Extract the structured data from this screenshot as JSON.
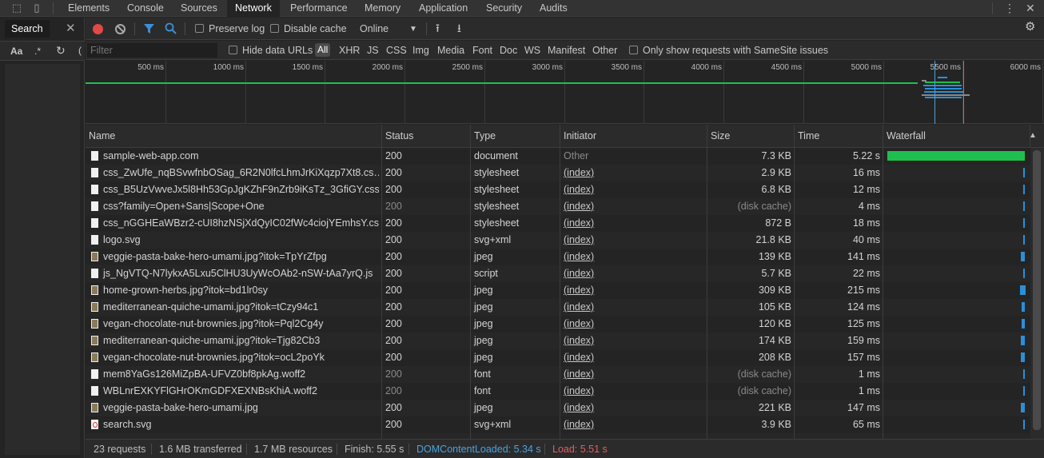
{
  "devtools": {
    "tabs": [
      "Elements",
      "Console",
      "Sources",
      "Network",
      "Performance",
      "Memory",
      "Application",
      "Security",
      "Audits"
    ],
    "active_tab": "Network"
  },
  "search_pane": {
    "tab_label": "Search",
    "match_case_label": "Aa",
    "regex_label": ".*"
  },
  "toolbar": {
    "preserve_log": "Preserve log",
    "disable_cache": "Disable cache",
    "throttling": "Online"
  },
  "filterbar": {
    "placeholder": "Filter",
    "hide_data_urls": "Hide data URLs",
    "types": [
      "All",
      "XHR",
      "JS",
      "CSS",
      "Img",
      "Media",
      "Font",
      "Doc",
      "WS",
      "Manifest",
      "Other"
    ],
    "samesite": "Only show requests with SameSite issues"
  },
  "overview": {
    "ticks": [
      "500 ms",
      "1000 ms",
      "1500 ms",
      "2000 ms",
      "2500 ms",
      "3000 ms",
      "3500 ms",
      "4000 ms",
      "4500 ms",
      "5000 ms",
      "5500 ms",
      "6000 ms"
    ],
    "dom_content_loaded_ms": 5340,
    "load_ms": 5510
  },
  "table": {
    "columns": [
      "Name",
      "Status",
      "Type",
      "Initiator",
      "Size",
      "Time",
      "Waterfall"
    ],
    "rows": [
      {
        "name": "sample-web-app.com",
        "status": "200",
        "type": "document",
        "initiator": "Other",
        "size": "7.3 KB",
        "time": "5.22 s",
        "icon": "doc",
        "status_dim": false,
        "size_dim": false,
        "init_link": false
      },
      {
        "name": "css_ZwUfe_nqBSvwfnbOSag_6R2N0lfcLhmJrKiXqzp7Xt8.cs…",
        "status": "200",
        "type": "stylesheet",
        "initiator": "(index)",
        "size": "2.9 KB",
        "time": "16 ms",
        "icon": "doc",
        "status_dim": false,
        "size_dim": false,
        "init_link": true
      },
      {
        "name": "css_B5UzVwveJx5l8Hh53GpJgKZhF9nZrb9iKsTz_3GfiGY.css…",
        "status": "200",
        "type": "stylesheet",
        "initiator": "(index)",
        "size": "6.8 KB",
        "time": "12 ms",
        "icon": "doc",
        "status_dim": false,
        "size_dim": false,
        "init_link": true
      },
      {
        "name": "css?family=Open+Sans|Scope+One",
        "status": "200",
        "type": "stylesheet",
        "initiator": "(index)",
        "size": "(disk cache)",
        "time": "4 ms",
        "icon": "doc",
        "status_dim": true,
        "size_dim": true,
        "init_link": true
      },
      {
        "name": "css_nGGHEaWBzr2-cUI8hzNSjXdQyIC02fWc4ciojYEmhsY.cs…",
        "status": "200",
        "type": "stylesheet",
        "initiator": "(index)",
        "size": "872 B",
        "time": "18 ms",
        "icon": "doc",
        "status_dim": false,
        "size_dim": false,
        "init_link": true
      },
      {
        "name": "logo.svg",
        "status": "200",
        "type": "svg+xml",
        "initiator": "(index)",
        "size": "21.8 KB",
        "time": "40 ms",
        "icon": "svg",
        "status_dim": false,
        "size_dim": false,
        "init_link": true
      },
      {
        "name": "veggie-pasta-bake-hero-umami.jpg?itok=TpYrZfpg",
        "status": "200",
        "type": "jpeg",
        "initiator": "(index)",
        "size": "139 KB",
        "time": "141 ms",
        "icon": "img",
        "status_dim": false,
        "size_dim": false,
        "init_link": true
      },
      {
        "name": "js_NgVTQ-N7lykxA5Lxu5ClHU3UyWcOAb2-nSW-tAa7yrQ.js",
        "status": "200",
        "type": "script",
        "initiator": "(index)",
        "size": "5.7 KB",
        "time": "22 ms",
        "icon": "doc",
        "status_dim": false,
        "size_dim": false,
        "init_link": true
      },
      {
        "name": "home-grown-herbs.jpg?itok=bd1lr0sy",
        "status": "200",
        "type": "jpeg",
        "initiator": "(index)",
        "size": "309 KB",
        "time": "215 ms",
        "icon": "img",
        "status_dim": false,
        "size_dim": false,
        "init_link": true
      },
      {
        "name": "mediterranean-quiche-umami.jpg?itok=tCzy94c1",
        "status": "200",
        "type": "jpeg",
        "initiator": "(index)",
        "size": "105 KB",
        "time": "124 ms",
        "icon": "img",
        "status_dim": false,
        "size_dim": false,
        "init_link": true
      },
      {
        "name": "vegan-chocolate-nut-brownies.jpg?itok=Pql2Cg4y",
        "status": "200",
        "type": "jpeg",
        "initiator": "(index)",
        "size": "120 KB",
        "time": "125 ms",
        "icon": "img",
        "status_dim": false,
        "size_dim": false,
        "init_link": true
      },
      {
        "name": "mediterranean-quiche-umami.jpg?itok=Tjg82Cb3",
        "status": "200",
        "type": "jpeg",
        "initiator": "(index)",
        "size": "174 KB",
        "time": "159 ms",
        "icon": "img",
        "status_dim": false,
        "size_dim": false,
        "init_link": true
      },
      {
        "name": "vegan-chocolate-nut-brownies.jpg?itok=ocL2poYk",
        "status": "200",
        "type": "jpeg",
        "initiator": "(index)",
        "size": "208 KB",
        "time": "157 ms",
        "icon": "img",
        "status_dim": false,
        "size_dim": false,
        "init_link": true
      },
      {
        "name": "mem8YaGs126MiZpBA-UFVZ0bf8pkAg.woff2",
        "status": "200",
        "type": "font",
        "initiator": "(index)",
        "size": "(disk cache)",
        "time": "1 ms",
        "icon": "doc",
        "status_dim": true,
        "size_dim": true,
        "init_link": true
      },
      {
        "name": "WBLnrEXKYFlGHrOKmGDFXEXNBsKhiA.woff2",
        "status": "200",
        "type": "font",
        "initiator": "(index)",
        "size": "(disk cache)",
        "time": "1 ms",
        "icon": "doc",
        "status_dim": true,
        "size_dim": true,
        "init_link": true
      },
      {
        "name": "veggie-pasta-bake-hero-umami.jpg",
        "status": "200",
        "type": "jpeg",
        "initiator": "(index)",
        "size": "221 KB",
        "time": "147 ms",
        "icon": "img",
        "status_dim": false,
        "size_dim": false,
        "init_link": true
      },
      {
        "name": "search.svg",
        "status": "200",
        "type": "svg+xml",
        "initiator": "(index)",
        "size": "3.9 KB",
        "time": "65 ms",
        "icon": "svgred",
        "status_dim": false,
        "size_dim": false,
        "init_link": true
      }
    ]
  },
  "status_bar": {
    "requests": "23 requests",
    "transferred": "1.6 MB transferred",
    "resources": "1.7 MB resources",
    "finish": "Finish: 5.55 s",
    "dcl": "DOMContentLoaded: 5.34 s",
    "load": "Load: 5.51 s"
  },
  "colors": {
    "record": "#e24848",
    "dcl": "#4aa3df",
    "load": "#e35d5d",
    "waterfall_green": "#1fbf4f",
    "waterfall_blue": "#2b8fd8"
  }
}
